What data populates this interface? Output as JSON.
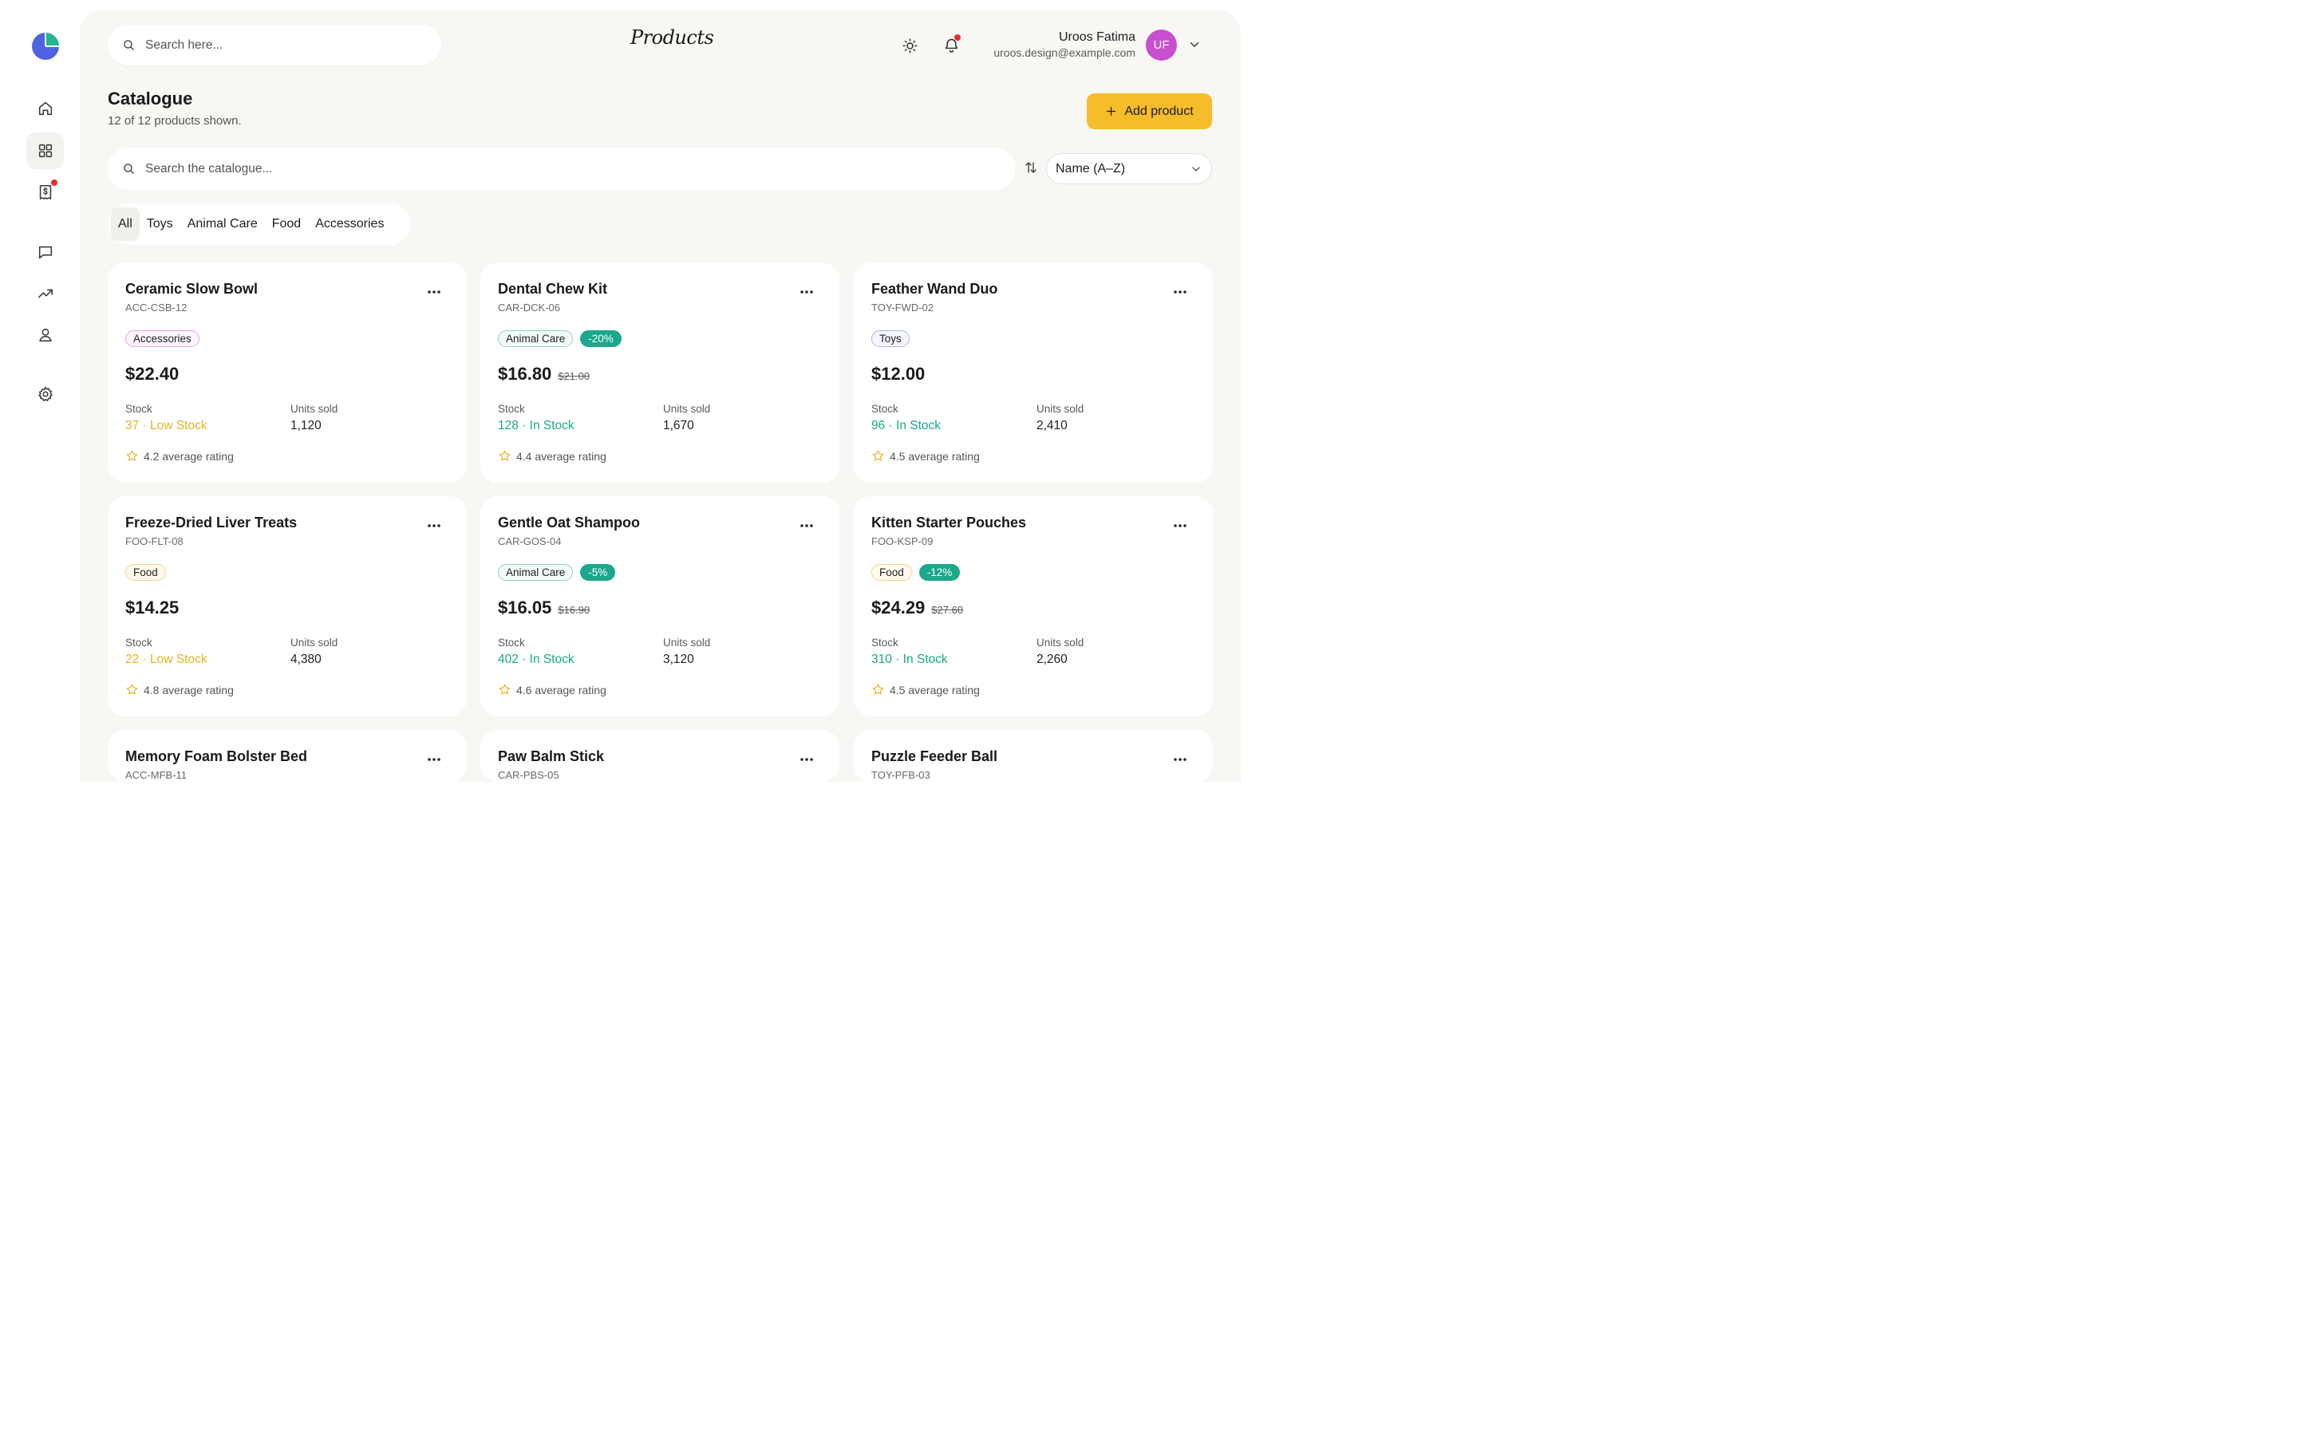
{
  "header": {
    "search_placeholder": "Search here...",
    "page_title": "Products",
    "user_name": "Uroos Fatima",
    "user_email": "uroos.design@example.com",
    "avatar_initials": "UF"
  },
  "catalogue": {
    "title": "Catalogue",
    "subtitle": "12 of 12 products shown.",
    "add_label": "Add product",
    "search_placeholder": "Search the catalogue...",
    "sort_value": "Name (A–Z)",
    "filters": [
      "All",
      "Toys",
      "Animal Care",
      "Food",
      "Accessories"
    ],
    "active_filter": "All"
  },
  "labels": {
    "stock": "Stock",
    "units_sold": "Units sold"
  },
  "products": [
    {
      "name": "Ceramic Slow Bowl",
      "sku": "ACC-CSB-12",
      "category": "Accessories",
      "discount": "",
      "price": "$22.40",
      "old_price": "",
      "stock": "37 · Low Stock",
      "stock_status": "low",
      "units_sold": "1,120",
      "rating": "4.2 average rating"
    },
    {
      "name": "Dental Chew Kit",
      "sku": "CAR-DCK-06",
      "category": "Animal Care",
      "discount": "-20%",
      "price": "$16.80",
      "old_price": "$21.00",
      "stock": "128 · In Stock",
      "stock_status": "in",
      "units_sold": "1,670",
      "rating": "4.4 average rating"
    },
    {
      "name": "Feather Wand Duo",
      "sku": "TOY-FWD-02",
      "category": "Toys",
      "discount": "",
      "price": "$12.00",
      "old_price": "",
      "stock": "96 · In Stock",
      "stock_status": "in",
      "units_sold": "2,410",
      "rating": "4.5 average rating"
    },
    {
      "name": "Freeze-Dried Liver Treats",
      "sku": "FOO-FLT-08",
      "category": "Food",
      "discount": "",
      "price": "$14.25",
      "old_price": "",
      "stock": "22 · Low Stock",
      "stock_status": "low",
      "units_sold": "4,380",
      "rating": "4.8 average rating"
    },
    {
      "name": "Gentle Oat Shampoo",
      "sku": "CAR-GOS-04",
      "category": "Animal Care",
      "discount": "-5%",
      "price": "$16.05",
      "old_price": "$16.90",
      "stock": "402 · In Stock",
      "stock_status": "in",
      "units_sold": "3,120",
      "rating": "4.6 average rating"
    },
    {
      "name": "Kitten Starter Pouches",
      "sku": "FOO-KSP-09",
      "category": "Food",
      "discount": "-12%",
      "price": "$24.29",
      "old_price": "$27.60",
      "stock": "310 · In Stock",
      "stock_status": "in",
      "units_sold": "2,260",
      "rating": "4.5 average rating"
    },
    {
      "name": "Memory Foam Bolster Bed",
      "sku": "ACC-MFB-11"
    },
    {
      "name": "Paw Balm Stick",
      "sku": "CAR-PBS-05"
    },
    {
      "name": "Puzzle Feeder Ball",
      "sku": "TOY-PFB-03"
    }
  ],
  "colors": {
    "accent": "#f6bd2a",
    "in_stock": "#1ba88a",
    "low_stock": "#e8b21f",
    "avatar": "#c84fd0",
    "notification": "#e5302a"
  },
  "icons": [
    "logo-icon",
    "home-icon",
    "grid-icon",
    "invoice-icon",
    "chat-icon",
    "trend-icon",
    "user-icon",
    "gear-icon",
    "search-icon",
    "sun-icon",
    "bell-icon",
    "chevron-down-icon",
    "plus-icon",
    "sort-icon",
    "more-icon",
    "star-icon"
  ]
}
